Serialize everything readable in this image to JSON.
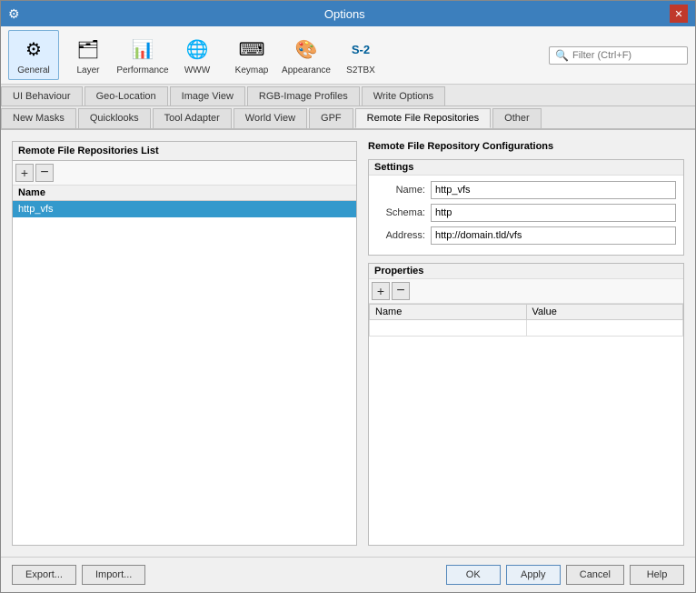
{
  "window": {
    "title": "Options",
    "close_btn": "✕"
  },
  "toolbar": {
    "items": [
      {
        "id": "general",
        "label": "General",
        "icon": "⚙",
        "active": true
      },
      {
        "id": "layer",
        "label": "Layer",
        "icon": "🗂"
      },
      {
        "id": "performance",
        "label": "Performance",
        "icon": "📊"
      },
      {
        "id": "www",
        "label": "WWW",
        "icon": "🌐"
      },
      {
        "id": "keymap",
        "label": "Keymap",
        "icon": "⌨"
      },
      {
        "id": "appearance",
        "label": "Appearance",
        "icon": "🎨"
      },
      {
        "id": "s2tbx",
        "label": "S2TBX",
        "icon": "S-2"
      }
    ],
    "filter_placeholder": "Filter (Ctrl+F)"
  },
  "tab_row1": {
    "tabs": [
      {
        "id": "ui-behaviour",
        "label": "UI Behaviour"
      },
      {
        "id": "geo-location",
        "label": "Geo-Location"
      },
      {
        "id": "image-view",
        "label": "Image View"
      },
      {
        "id": "rgb-image-profiles",
        "label": "RGB-Image Profiles"
      },
      {
        "id": "write-options",
        "label": "Write Options"
      }
    ]
  },
  "tab_row2": {
    "tabs": [
      {
        "id": "new-masks",
        "label": "New Masks"
      },
      {
        "id": "quicklooks",
        "label": "Quicklooks"
      },
      {
        "id": "tool-adapter",
        "label": "Tool Adapter"
      },
      {
        "id": "world-view",
        "label": "World View"
      },
      {
        "id": "gpf",
        "label": "GPF"
      },
      {
        "id": "remote-file-repositories",
        "label": "Remote File Repositories",
        "active": true
      },
      {
        "id": "other",
        "label": "Other"
      }
    ]
  },
  "left_panel": {
    "title": "Remote File Repositories List",
    "add_btn": "+",
    "remove_btn": "−",
    "column_header": "Name",
    "items": [
      {
        "id": "http_vfs",
        "name": "http_vfs",
        "selected": true
      }
    ]
  },
  "right_panel": {
    "title": "Remote File Repository Configurations",
    "settings": {
      "title": "Settings",
      "fields": [
        {
          "label": "Name:",
          "value": "http_vfs",
          "id": "name-field"
        },
        {
          "label": "Schema:",
          "value": "http",
          "id": "schema-field"
        },
        {
          "label": "Address:",
          "value": "http://domain.tld/vfs",
          "id": "address-field"
        }
      ]
    },
    "properties": {
      "title": "Properties",
      "add_btn": "+",
      "remove_btn": "−",
      "columns": [
        {
          "label": "Name"
        },
        {
          "label": "Value"
        }
      ],
      "rows": []
    }
  },
  "footer": {
    "export_btn": "Export...",
    "import_btn": "Import...",
    "ok_btn": "OK",
    "apply_btn": "Apply",
    "cancel_btn": "Cancel",
    "help_btn": "Help"
  }
}
